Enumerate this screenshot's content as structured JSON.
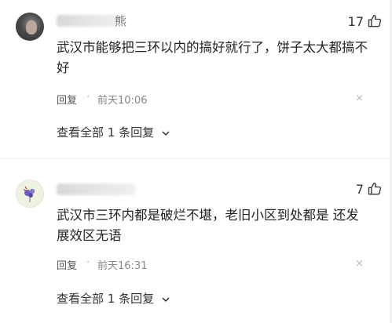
{
  "comments": [
    {
      "name_suffix": "熊",
      "likes": "17",
      "text": "武汉市能够把三环以内的搞好就行了，饼子太大都搞不好",
      "reply_label": "回复",
      "separator": "·",
      "time": "前天10:06",
      "close_symbol": "×",
      "view_all": "查看全部 1 条回复"
    },
    {
      "name_suffix": "",
      "likes": "7",
      "text": "武汉市三环内都是破烂不堪，老旧小区到处都是 还发展效区无语",
      "reply_label": "回复",
      "separator": "·",
      "time": "前天16:31",
      "close_symbol": "×",
      "view_all": "查看全部 1 条回复"
    }
  ],
  "icons": {
    "like": "thumbs-up-icon",
    "expand": "chevron-down-icon",
    "close": "close-icon"
  }
}
